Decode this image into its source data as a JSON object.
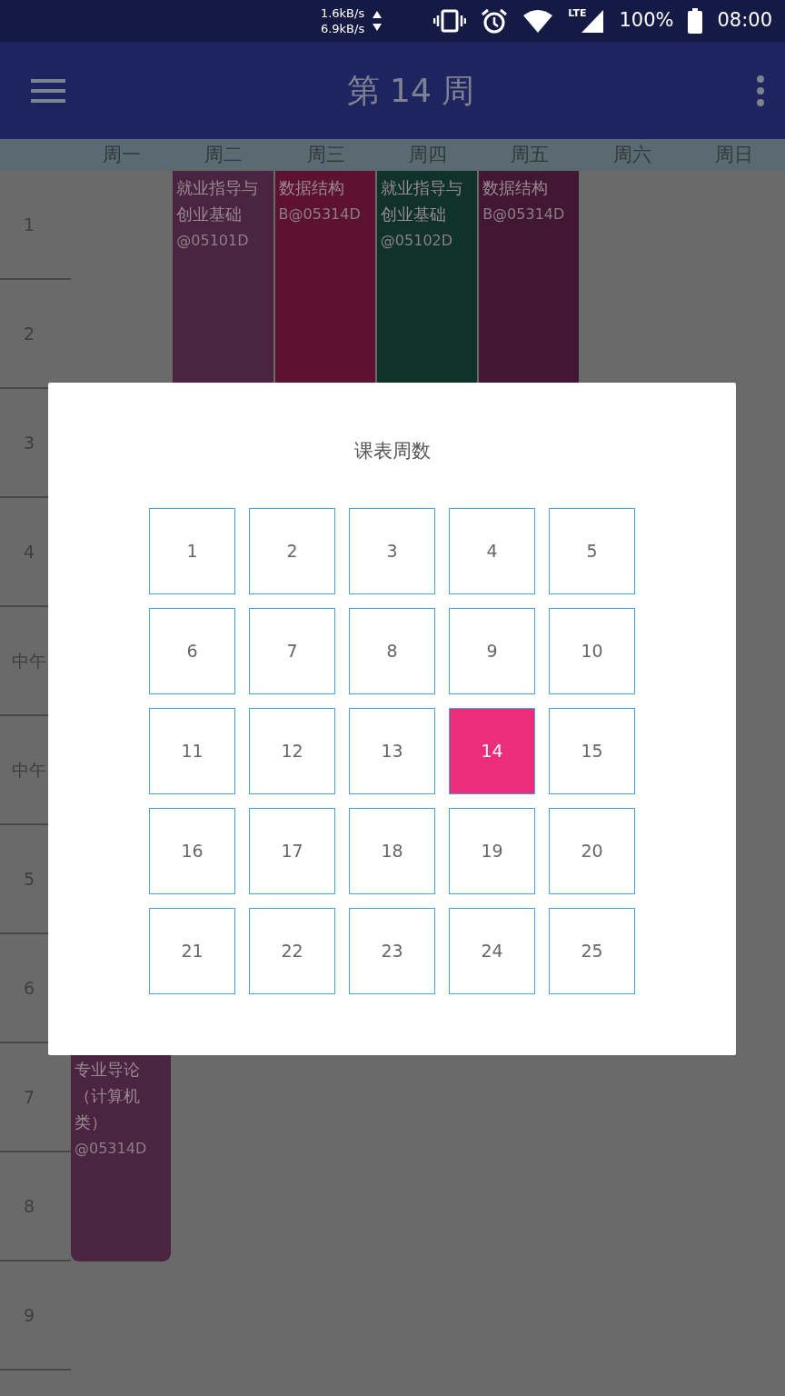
{
  "status_bar": {
    "net_up": "1.6kB/s",
    "net_down": "6.9kB/s",
    "network_type": "LTE",
    "battery": "100%",
    "time": "08:00"
  },
  "app_bar": {
    "title": "第 14 周"
  },
  "timetable": {
    "days": [
      {
        "label": "周一",
        "cells": [
          {
            "kind": "empty"
          },
          {
            "kind": "empty"
          },
          {
            "kind": "empty"
          },
          {
            "kind": "empty"
          },
          {
            "kind": "empty"
          },
          {
            "kind": "empty"
          },
          {
            "kind": "empty"
          },
          {
            "kind": "empty"
          },
          {
            "kind": "course",
            "name": "专业导论（计算机类）",
            "room": "@05314D",
            "color": "#4a2440"
          },
          {
            "kind": "continued"
          }
        ]
      },
      {
        "label": "周二",
        "cells": [
          {
            "kind": "course",
            "name": "就业指导与创业基础",
            "room": "@05101D",
            "color": "#4a2440"
          },
          {
            "kind": "continued"
          }
        ]
      },
      {
        "label": "周三",
        "cells": [
          {
            "kind": "course",
            "name": "数据结构",
            "room": "B@05314D",
            "color": "#5c1230"
          },
          {
            "kind": "continued"
          }
        ]
      },
      {
        "label": "周四",
        "cells": [
          {
            "kind": "course",
            "name": "就业指导与创业基础",
            "room": "@05102D",
            "color": "#0f3328"
          },
          {
            "kind": "continued"
          }
        ]
      },
      {
        "label": "周五",
        "cells": [
          {
            "kind": "course",
            "name": "数据结构",
            "room": "B@05314D",
            "color": "#421733"
          },
          {
            "kind": "continued"
          }
        ]
      },
      {
        "label": "周六"
      },
      {
        "label": "周日"
      }
    ],
    "periods": [
      "1",
      "2",
      "3",
      "4",
      "中午",
      "中午",
      "5",
      "6",
      "7",
      "8",
      "9"
    ]
  },
  "week_dialog": {
    "title": "课表周数",
    "weeks": [
      {
        "label": "1",
        "selected": false
      },
      {
        "label": "2",
        "selected": false
      },
      {
        "label": "3",
        "selected": false
      },
      {
        "label": "4",
        "selected": false
      },
      {
        "label": "5",
        "selected": false
      },
      {
        "label": "6",
        "selected": false
      },
      {
        "label": "7",
        "selected": false
      },
      {
        "label": "8",
        "selected": false
      },
      {
        "label": "9",
        "selected": false
      },
      {
        "label": "10",
        "selected": false
      },
      {
        "label": "11",
        "selected": false
      },
      {
        "label": "12",
        "selected": false
      },
      {
        "label": "13",
        "selected": false
      },
      {
        "label": "14",
        "selected": true
      },
      {
        "label": "15",
        "selected": false
      },
      {
        "label": "16",
        "selected": false
      },
      {
        "label": "17",
        "selected": false
      },
      {
        "label": "18",
        "selected": false
      },
      {
        "label": "19",
        "selected": false
      },
      {
        "label": "20",
        "selected": false
      },
      {
        "label": "21",
        "selected": false
      },
      {
        "label": "22",
        "selected": false
      },
      {
        "label": "23",
        "selected": false
      },
      {
        "label": "24",
        "selected": false
      },
      {
        "label": "25",
        "selected": false
      }
    ]
  }
}
